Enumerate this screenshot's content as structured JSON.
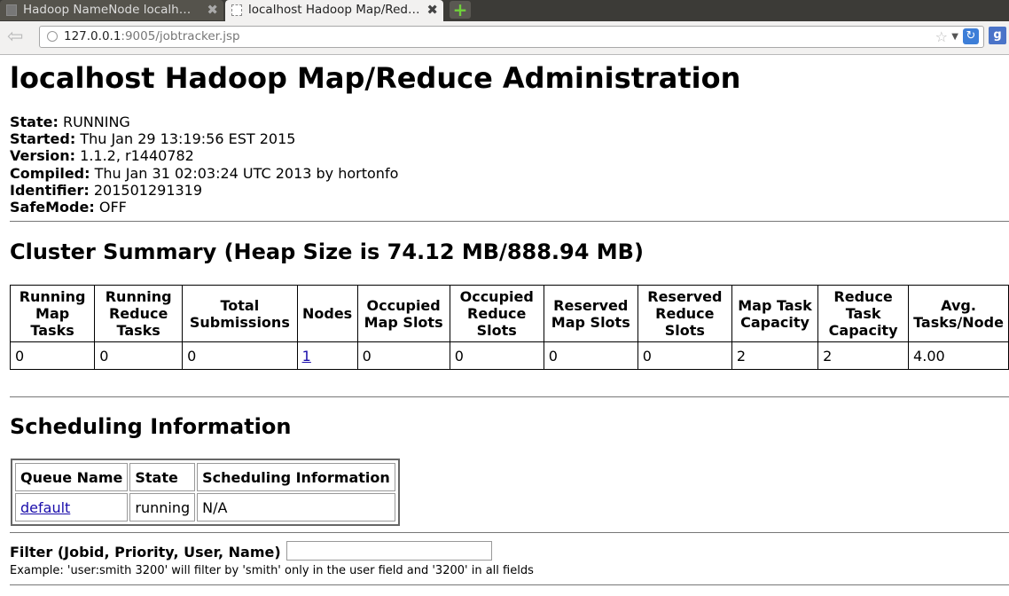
{
  "browser": {
    "tabs": [
      {
        "title": "Hadoop NameNode localh…",
        "close": "✖"
      },
      {
        "title": "localhost Hadoop Map/Red…",
        "close": "✖"
      }
    ],
    "new_tab": "+",
    "url_host": "127.0.0.1",
    "url_rest": ":9005/jobtracker.jsp",
    "search_engine_icon": "g"
  },
  "page": {
    "title": "localhost Hadoop Map/Reduce Administration",
    "info": [
      {
        "label": "State:",
        "value": "RUNNING"
      },
      {
        "label": "Started:",
        "value": "Thu Jan 29 13:19:56 EST 2015"
      },
      {
        "label": "Version:",
        "value": "1.1.2, r1440782"
      },
      {
        "label": "Compiled:",
        "value": "Thu Jan 31 02:03:24 UTC 2013 by hortonfo"
      },
      {
        "label": "Identifier:",
        "value": "201501291319"
      },
      {
        "label": "SafeMode:",
        "value": "OFF"
      }
    ],
    "cluster_summary_heading": "Cluster Summary (Heap Size is 74.12 MB/888.94 MB)",
    "cluster_table": {
      "headers": [
        "Running Map Tasks",
        "Running Reduce Tasks",
        "Total Submissions",
        "Nodes",
        "Occupied Map Slots",
        "Occupied Reduce Slots",
        "Reserved Map Slots",
        "Reserved Reduce Slots",
        "Map Task Capacity",
        "Reduce Task Capacity",
        "Avg. Tasks/Node"
      ],
      "row": [
        "0",
        "0",
        "0",
        "1",
        "0",
        "0",
        "0",
        "0",
        "2",
        "2",
        "4.00"
      ]
    },
    "scheduling_heading": "Scheduling Information",
    "sched_table": {
      "headers": [
        "Queue Name",
        "State",
        "Scheduling Information"
      ],
      "rows": [
        [
          "default",
          "running",
          "N/A"
        ]
      ]
    },
    "filter_label": "Filter (Jobid, Priority, User, Name)",
    "filter_value": "",
    "filter_example": "Example: 'user:smith 3200' will filter by 'smith' only in the user field and '3200' in all fields"
  }
}
